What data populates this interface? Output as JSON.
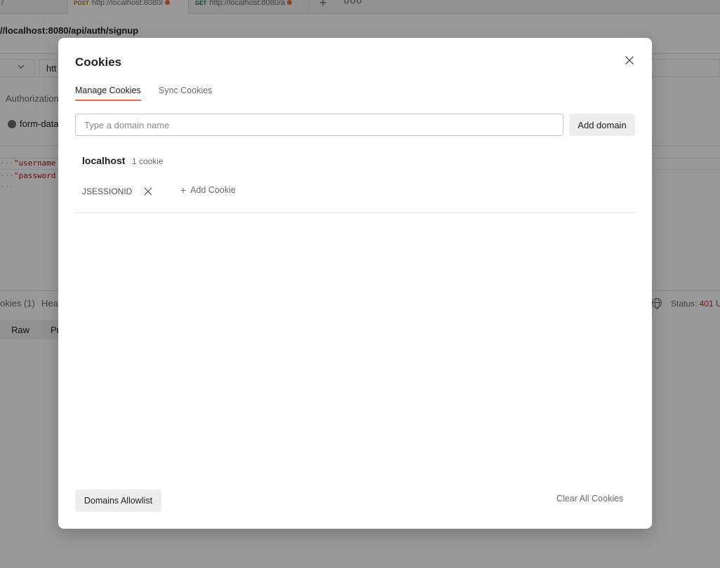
{
  "background": {
    "tabs": [
      {
        "label": "/"
      },
      {
        "method": "POST",
        "label": "http://localhost:8080/"
      },
      {
        "method": "GET",
        "label": "http://localhost:8080/a"
      }
    ],
    "request_name": "//localhost:8080/api/auth/signup",
    "url_value": "htt",
    "subtab_label": "Authorization",
    "body_type_label": "form-data",
    "body_lines": [
      "\"username",
      "\"password"
    ],
    "response_tabs": [
      "okies (1)",
      "Hea"
    ],
    "status_label": "Status:",
    "status_value": "401 U",
    "format_tabs": [
      "Raw",
      "Pr"
    ]
  },
  "modal": {
    "title": "Cookies",
    "tabs": [
      {
        "label": "Manage Cookies",
        "active": true
      },
      {
        "label": "Sync Cookies",
        "active": false
      }
    ],
    "domain_input": {
      "placeholder": "Type a domain name",
      "value": ""
    },
    "add_domain_label": "Add domain",
    "domains": [
      {
        "name": "localhost",
        "count_label": "1 cookie",
        "cookies": [
          "JSESSIONID"
        ],
        "add_cookie_label": "Add Cookie"
      }
    ],
    "allowlist_label": "Domains Allowlist",
    "clear_all_label": "Clear All Cookies"
  },
  "colors": {
    "accent": "#f26b3a",
    "status_error": "#c5301f",
    "overlay": "rgba(0,0,0,0.4)"
  },
  "icons": [
    "close-icon",
    "remove-cookie-icon",
    "plus-icon",
    "globe-icon",
    "chevron-down-icon"
  ]
}
